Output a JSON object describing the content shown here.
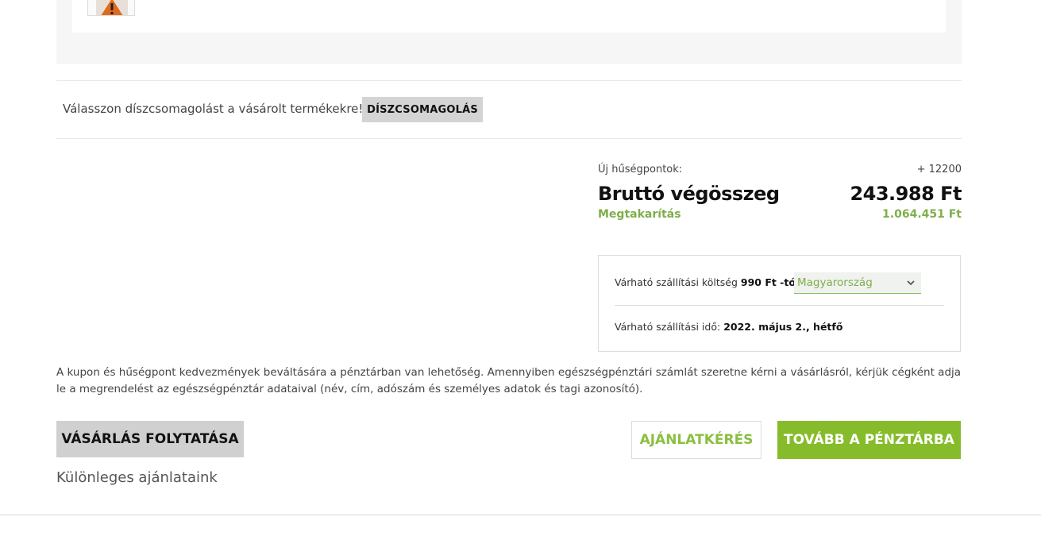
{
  "gift_wrap": {
    "prompt": "Válasszon díszcsomagolást a vásárolt termékekre!",
    "button_label": "DÍSZCSOMAGOLÁS"
  },
  "summary": {
    "loyalty_label": "Új hűségpontok:",
    "loyalty_value": "+ 12200",
    "total_label": "Bruttó végösszeg",
    "total_value": "243.988 Ft",
    "savings_label": "Megtakarítás",
    "savings_value": "1.064.451 Ft"
  },
  "shipping": {
    "cost_prefix": "Várható szállítási költség",
    "cost_value": "990 Ft -tól",
    "country_selected": "Magyarország",
    "time_prefix": "Várható szállítási idő:",
    "time_value": "2022. május 2., hétfő"
  },
  "notice": "A kupon és hűségpont kedvezmények beváltására a pénztárban van lehetőség. Amennyiben egészségpénztári számlát szeretne kérni a vásárlásról, kérjük cégként adja le a megrendelést az egészségpénztár adataival (név, cím, adószám és személyes adatok és tagi azonosító).",
  "actions": {
    "continue_label": "VÁSÁRLÁS FOLYTATÁSA",
    "quote_label": "AJÁNLATKÉRÉS",
    "checkout_label": "TOVÁBB A PÉNZTÁRBA"
  },
  "special_offers_title": "Különleges ajánlataink",
  "colors": {
    "accent_green": "#86bc2b",
    "savings_green": "#7fae4b",
    "button_gray": "#d0d0d0"
  },
  "icons": {
    "product_thumbnail": "warning-sign-product-icon",
    "select_arrow": "chevron-down-icon"
  }
}
